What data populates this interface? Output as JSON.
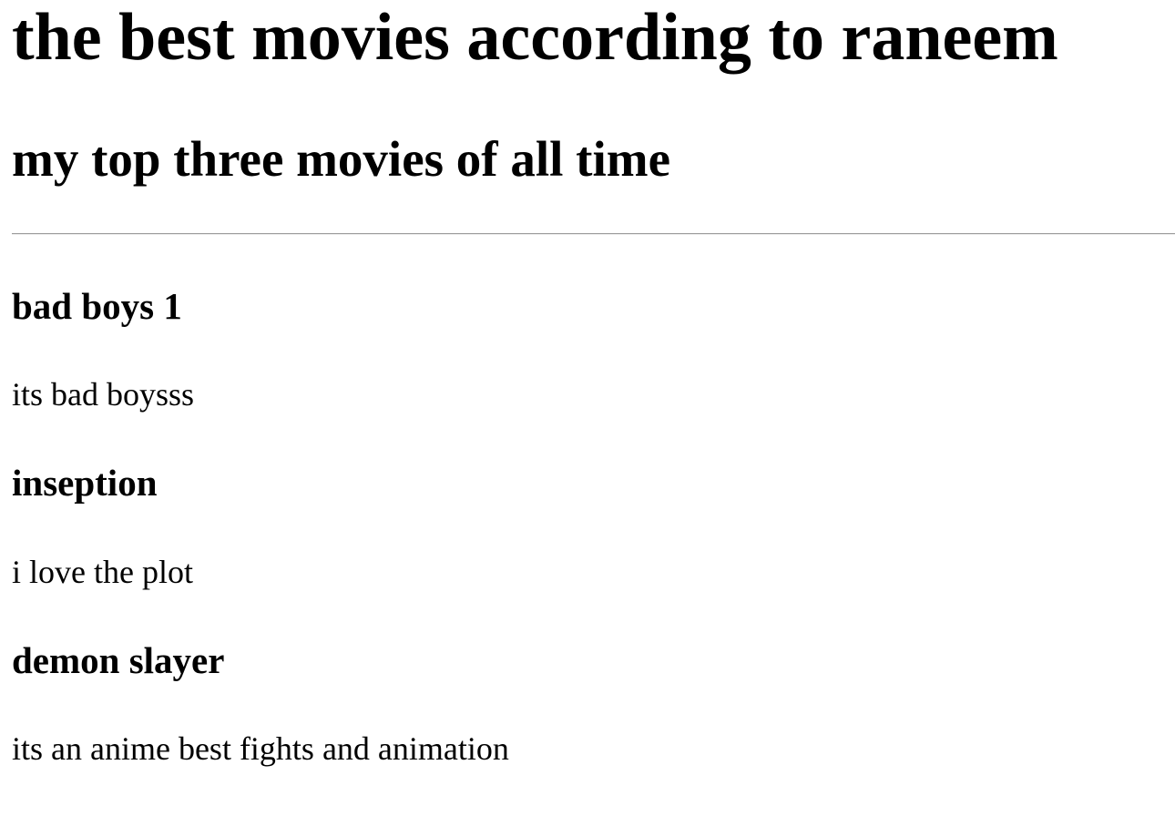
{
  "page": {
    "title": "the best movies according to raneem",
    "subtitle": "my top three movies of all time"
  },
  "movies": [
    {
      "title": "bad boys 1",
      "description": "its bad boysss"
    },
    {
      "title": "inseption",
      "description": "i love the plot"
    },
    {
      "title": "demon slayer",
      "description": "its an anime best fights and animation"
    }
  ]
}
